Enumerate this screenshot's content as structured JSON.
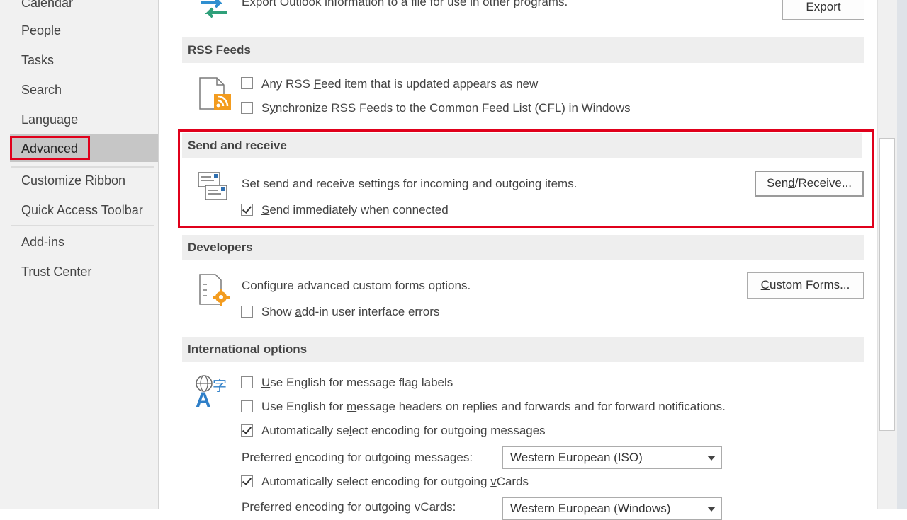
{
  "sidebar": {
    "items": [
      {
        "label": "Calendar"
      },
      {
        "label": "People"
      },
      {
        "label": "Tasks"
      },
      {
        "label": "Search"
      },
      {
        "label": "Language"
      },
      {
        "label": "Advanced"
      },
      {
        "label": "Customize Ribbon"
      },
      {
        "label": "Quick Access Toolbar"
      },
      {
        "label": "Add-ins"
      },
      {
        "label": "Trust Center"
      }
    ],
    "selected": "Advanced"
  },
  "export": {
    "description": "Export Outlook information to a file for use in other programs.",
    "button_label": "Export"
  },
  "rss": {
    "header": "RSS Feeds",
    "option1": {
      "pre": "Any RSS ",
      "accel": "F",
      "post": "eed item that is updated appears as new",
      "checked": false
    },
    "option2": {
      "pre": "S",
      "accel": "y",
      "post": "nchronize RSS Feeds to the Common Feed List (CFL) in Windows",
      "checked": false
    }
  },
  "send_receive": {
    "header": "Send and receive",
    "description": "Set send and receive settings for incoming and outgoing items.",
    "button": {
      "pre": "Sen",
      "accel": "d",
      "post": "/Receive..."
    },
    "option1": {
      "pre": "",
      "accel": "S",
      "post": "end immediately when connected",
      "checked": true
    }
  },
  "developers": {
    "header": "Developers",
    "description": "Configure advanced custom forms options.",
    "button": {
      "pre": "",
      "accel": "C",
      "post": "ustom Forms..."
    },
    "option1": {
      "pre": "Show ",
      "accel": "a",
      "post": "dd-in user interface errors",
      "checked": false
    }
  },
  "international": {
    "header": "International options",
    "option1": {
      "pre": "",
      "accel": "U",
      "post": "se English for message flag labels",
      "checked": false
    },
    "option2": {
      "pre": "Use English for ",
      "accel": "m",
      "post": "essage headers on replies and forwards and for forward notifications.",
      "checked": false
    },
    "option3": {
      "pre": "Automatically se",
      "accel": "l",
      "post": "ect encoding for outgoing messages",
      "checked": true
    },
    "encoding_label": {
      "pre": "Preferred ",
      "accel": "e",
      "post": "ncoding for outgoing messages:"
    },
    "encoding_value": "Western European (ISO)",
    "option4": {
      "pre": "Automatically select encoding for outgoing ",
      "accel": "v",
      "post": "Cards",
      "checked": true
    },
    "vcard_label": {
      "pre": "Preferred encoding for outgoing vCards:",
      "accel": "",
      "post": ""
    },
    "vcard_value": "Western European (Windows)"
  },
  "colors": {
    "accent_red": "#e0001b",
    "selected_bg": "#c6c6c6",
    "section_bg": "#eeeeee"
  }
}
